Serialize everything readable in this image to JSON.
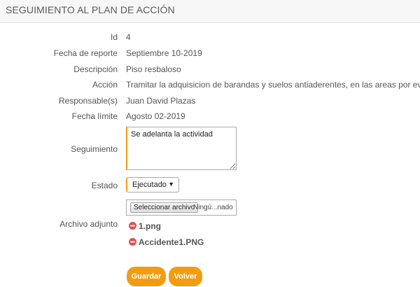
{
  "header": {
    "title": "SEGUIMIENTO AL PLAN DE ACCIÓN"
  },
  "fields": {
    "id": {
      "label": "Id",
      "value": "4"
    },
    "fecha_reporte": {
      "label": "Fecha de reporte",
      "value": "Septiembre 10-2019"
    },
    "descripcion": {
      "label": "Descripción",
      "value": "Piso resbaloso"
    },
    "accion": {
      "label": "Acción",
      "value": "Tramitar la adquisicion de barandas y suelos antiaderentes, en las areas por evaluar"
    },
    "responsables": {
      "label": "Responsable(s)",
      "value": "Juan David Plazas"
    },
    "fecha_limite": {
      "label": "Fecha límite",
      "value": "Agosto 02-2019"
    }
  },
  "seguimiento": {
    "label": "Seguimiento",
    "value": "Se adelanta la actividad"
  },
  "estado": {
    "label": "Estado",
    "selected": "Ejecutado",
    "arrow_icon": "triangle-down-icon"
  },
  "archivo": {
    "label": "Archivo adjunto",
    "button_label": "Seleccionar archivo",
    "status": "Ningú...nado",
    "files": [
      {
        "name": "1.png",
        "icon": "remove-circle-icon"
      },
      {
        "name": "Accidente1.PNG",
        "icon": "remove-circle-icon"
      }
    ]
  },
  "actions": {
    "save_label": "Guardar",
    "back_label": "Volver"
  },
  "colors": {
    "accent": "#f39c12",
    "delete_icon": "#d9534f",
    "text": "#555555",
    "header_bg": "#f7f7f7"
  }
}
